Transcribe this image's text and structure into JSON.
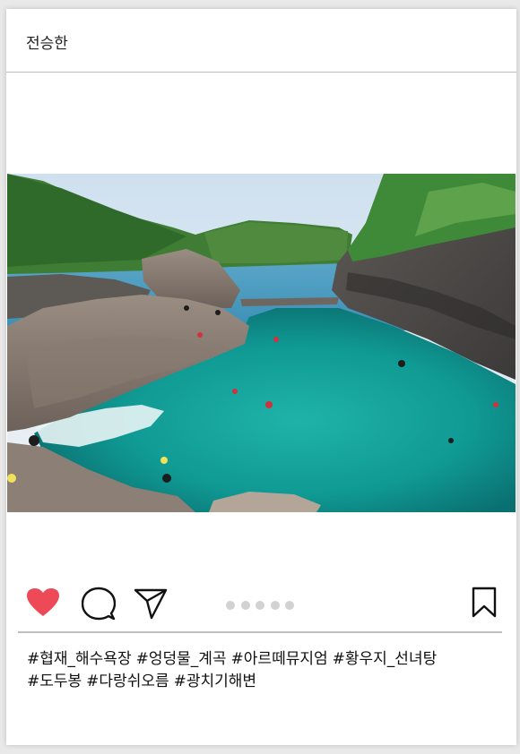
{
  "post": {
    "username": "전승한",
    "photo_alt": "",
    "hashtags": [
      "#협재_해수욕장",
      "#엉덩물_계곡",
      "#아르떼뮤지엄",
      "#황우지_선녀탕",
      "#도두봉",
      "#다랑쉬오름",
      "#광치기해변"
    ]
  },
  "actions": {
    "like_icon": "heart-filled-icon",
    "comment_icon": "speech-bubble-icon",
    "share_icon": "paper-plane-icon",
    "save_icon": "bookmark-icon",
    "carousel_dots": 5,
    "like_color": "#ed4956"
  },
  "colors": {
    "background": "#e9e9e9",
    "card": "#ffffff",
    "divider": "#bdbdbd",
    "dot": "#d2d2d2"
  }
}
